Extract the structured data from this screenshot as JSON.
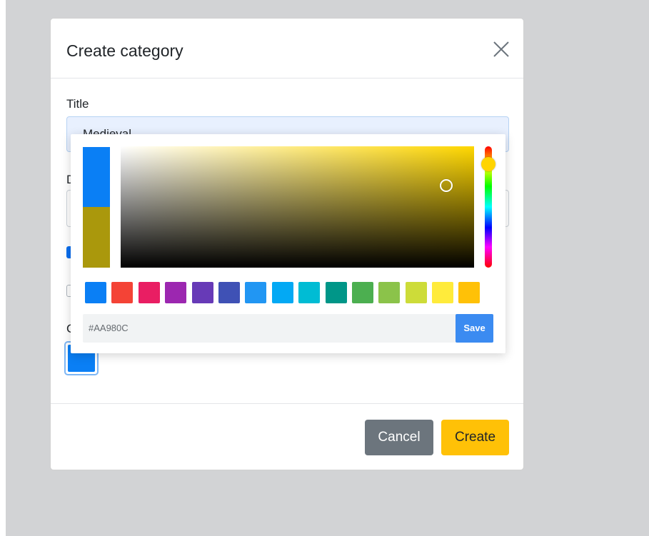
{
  "modal": {
    "title": "Create category",
    "fields": {
      "title_label": "Title",
      "title_value": "Medieval",
      "description_label_partial": "D",
      "color_label_partial": "C"
    },
    "footer": {
      "cancel_label": "Cancel",
      "create_label": "Create"
    }
  },
  "picker": {
    "new_color": "#0a7ff5",
    "old_color": "#AA980C",
    "hue_color": "#ffd700",
    "hex_value": "#AA980C",
    "save_label": "Save",
    "swatches": [
      "#0a7ff5",
      "#f44336",
      "#e91e63",
      "#9c27b0",
      "#673ab7",
      "#3f51b5",
      "#2196f3",
      "#03a9f4",
      "#00bcd4",
      "#009688",
      "#4caf50",
      "#8bc34a",
      "#cddc39",
      "#ffeb3b",
      "#ffc107"
    ]
  },
  "colors": {
    "backdrop": "#d2d3d5",
    "cancel": "#6c757d",
    "create": "#ffc107",
    "save": "#3b8bf1"
  }
}
